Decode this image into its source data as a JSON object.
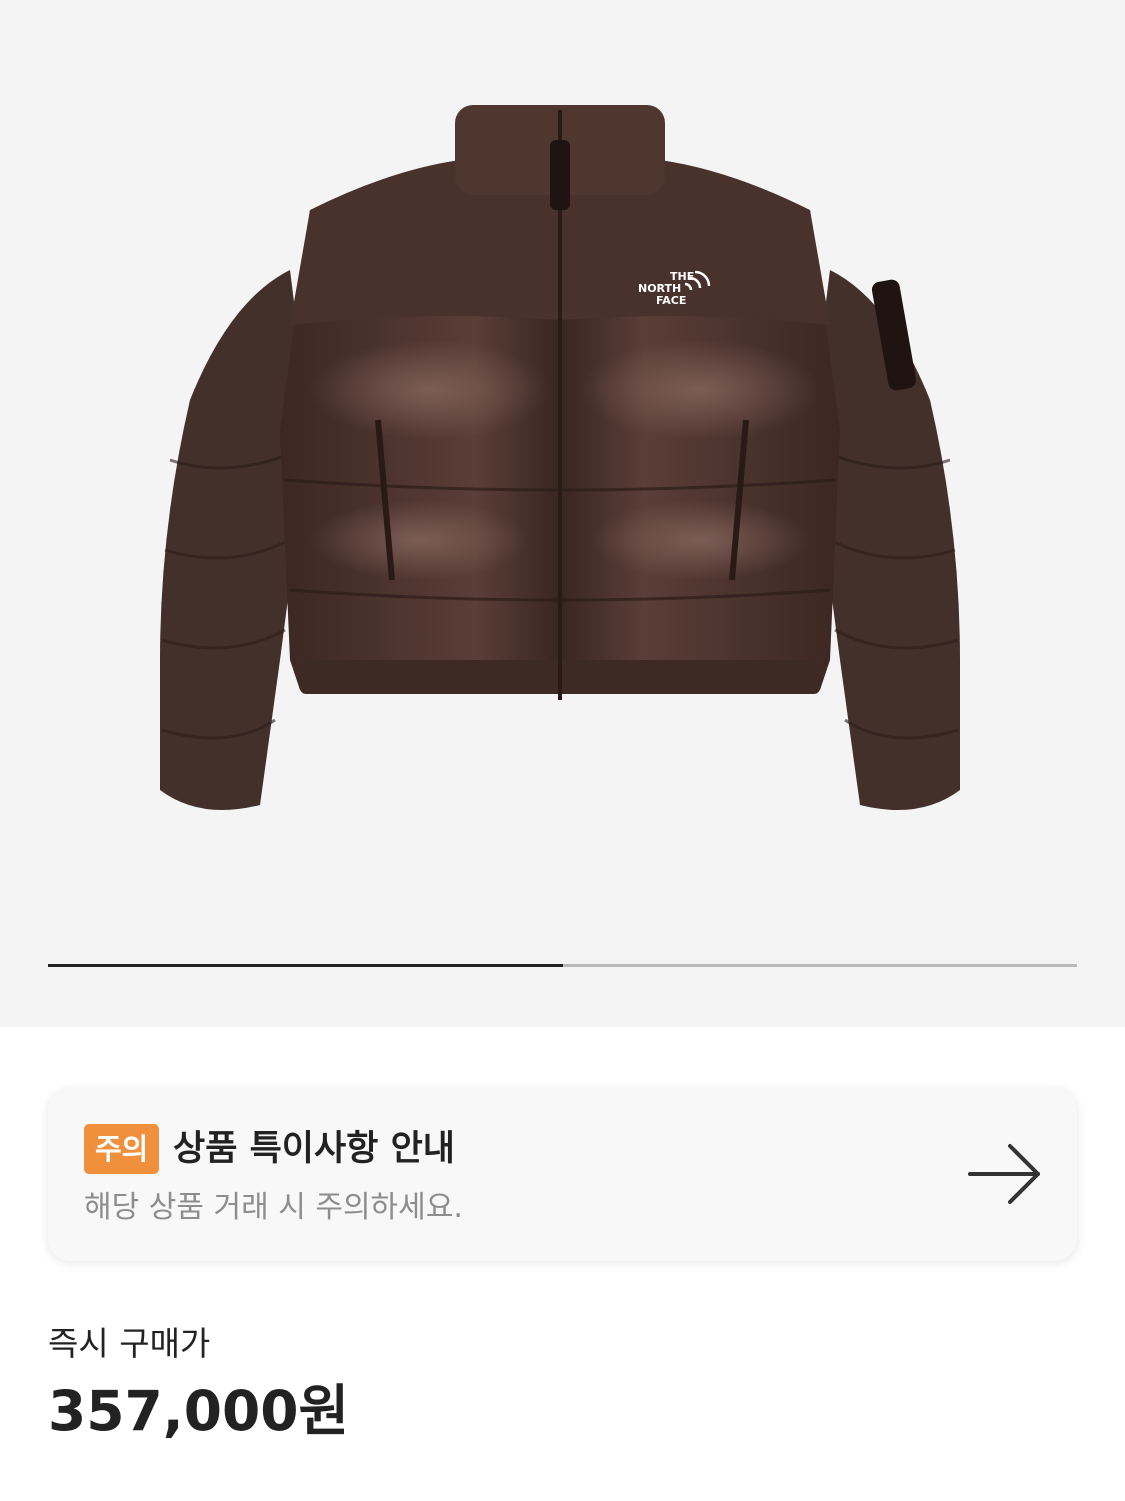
{
  "product": {
    "image_icon": "puffer-jacket-image",
    "brand_logo_line1": "THE",
    "brand_logo_line2": "NORTH",
    "brand_logo_line3": "FACE",
    "image_bg_color": "#f4f4f4",
    "jacket_color": "#4a322c"
  },
  "gallery": {
    "current_image": 1,
    "total_images": 2
  },
  "notice": {
    "badge": "주의",
    "title": "상품 특이사항 안내",
    "subtitle": "해당 상품 거래 시 주의하세요.",
    "arrow_icon": "arrow-right-icon",
    "badge_color": "#f0903c"
  },
  "price": {
    "label": "즉시 구매가",
    "value": "357,000원"
  }
}
